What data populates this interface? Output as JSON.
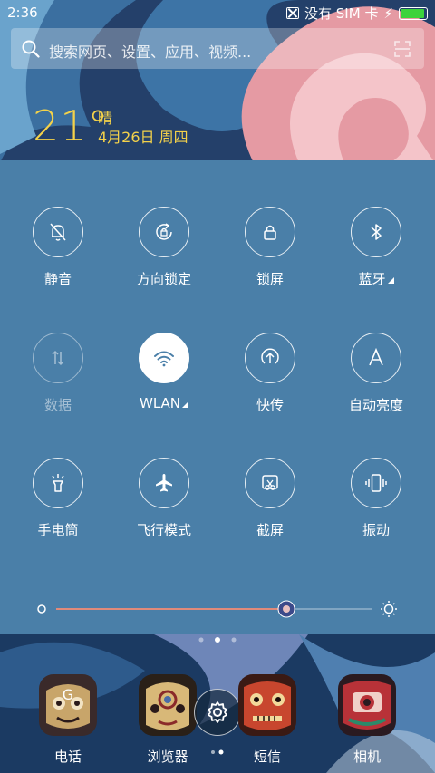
{
  "status": {
    "time": "2:36",
    "sim_text": "没有 SIM 卡",
    "battery_color": "#3cd33c"
  },
  "search": {
    "placeholder": "搜索网页、设置、应用、视频..."
  },
  "weather": {
    "temp": "21°",
    "condition": "晴",
    "date": "4月26日 周四",
    "color": "#f4d24a"
  },
  "panel": {
    "background": "#4a7fa8",
    "toggles": [
      {
        "label": "静音",
        "icon": "bell-off-icon",
        "state": "off"
      },
      {
        "label": "方向锁定",
        "icon": "rotation-lock-icon",
        "state": "off"
      },
      {
        "label": "锁屏",
        "icon": "lock-icon",
        "state": "off"
      },
      {
        "label": "蓝牙",
        "icon": "bluetooth-icon",
        "state": "off"
      },
      {
        "label": "数据",
        "icon": "data-icon",
        "state": "disabled"
      },
      {
        "label": "WLAN",
        "icon": "wifi-icon",
        "state": "on"
      },
      {
        "label": "快传",
        "icon": "quick-send-icon",
        "state": "off"
      },
      {
        "label": "自动亮度",
        "icon": "auto-brightness-icon",
        "state": "off"
      },
      {
        "label": "手电筒",
        "icon": "flashlight-icon",
        "state": "off"
      },
      {
        "label": "飞行模式",
        "icon": "airplane-icon",
        "state": "off"
      },
      {
        "label": "截屏",
        "icon": "screenshot-icon",
        "state": "off"
      },
      {
        "label": "振动",
        "icon": "vibrate-icon",
        "state": "off"
      }
    ],
    "brightness_level": 0.73
  },
  "dock": {
    "apps": [
      {
        "label": "电话",
        "icon": "phone-app-icon"
      },
      {
        "label": "浏览器",
        "icon": "browser-app-icon"
      },
      {
        "label": "短信",
        "icon": "messages-app-icon"
      },
      {
        "label": "相机",
        "icon": "camera-app-icon"
      }
    ]
  }
}
